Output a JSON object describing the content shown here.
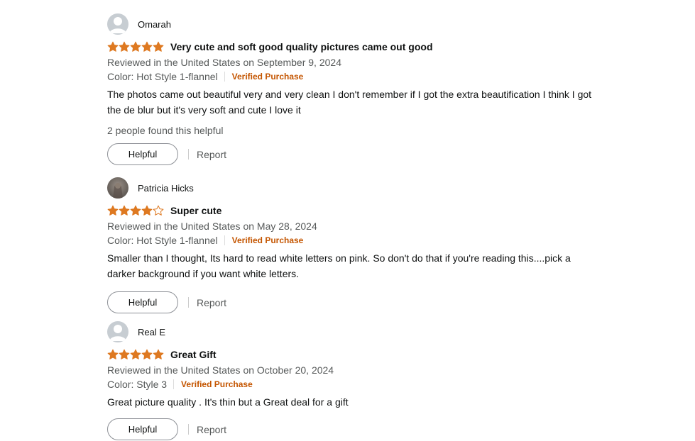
{
  "colors": {
    "star": "#de7921",
    "verified": "#c45500",
    "muted": "#565959",
    "text": "#0f1111"
  },
  "labels": {
    "helpful_button": "Helpful",
    "report_link": "Report"
  },
  "reviews": [
    {
      "name": "Omarah",
      "avatar": "default-avatar",
      "rating": 5,
      "title": "Very cute and soft good quality pictures came out good",
      "reviewed": "Reviewed in the United States on September 9, 2024",
      "color": "Color: Hot Style 1-flannel",
      "verified": "Verified Purchase",
      "body": "The photos came out beautiful very and very clean I don't remember if I got the extra beautification I think I got the de blur but it's very soft and cute I love it",
      "helpful_count": "2 people found this helpful"
    },
    {
      "name": "Patricia Hicks",
      "avatar": "photo-avatar",
      "rating": 4,
      "title": "Super cute",
      "reviewed": "Reviewed in the United States on May 28, 2024",
      "color": "Color: Hot Style 1-flannel",
      "verified": "Verified Purchase",
      "body": "Smaller than I thought, Its hard to read white letters on pink. So don't do that if you're reading this....pick a darker background if you want white letters."
    },
    {
      "name": "Real E",
      "avatar": "default-avatar",
      "rating": 5,
      "title": "Great Gift",
      "reviewed": "Reviewed in the United States on October 20, 2024",
      "color": "Color: Style 3",
      "verified": "Verified Purchase",
      "body": "Great picture quality . It's thin but a Great deal for a gift"
    }
  ]
}
